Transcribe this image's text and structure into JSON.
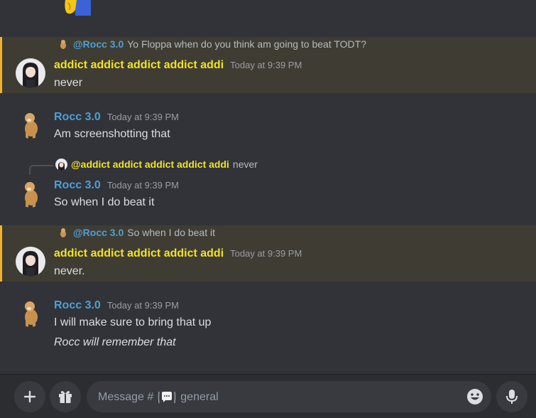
{
  "colors": {
    "background": "#313338",
    "highlight": "#3f3d33",
    "highlight_border": "#f0b232",
    "username_yellow": "#f2e22a",
    "username_blue": "#4e9fd6"
  },
  "messages": [
    {
      "reply": {
        "user": "@Rocc 3.0",
        "text": "Yo Floppa when do you think am going to beat TODT?"
      },
      "user": "addict addict addict addict addi",
      "time": "Today at 9:39 PM",
      "lines": [
        "never"
      ],
      "avatar": "anime-girl-avatar",
      "highlighted": true
    },
    {
      "user": "Rocc 3.0",
      "time": "Today at 9:39 PM",
      "lines": [
        "Am screenshotting that"
      ],
      "avatar": "cheems-dog-avatar"
    },
    {
      "reply": {
        "user": "@addict addict addict addict addi",
        "text": "never"
      },
      "user": "Rocc 3.0",
      "time": "Today at 9:39 PM",
      "lines": [
        "So when I do beat it"
      ],
      "avatar": "cheems-dog-avatar"
    },
    {
      "reply": {
        "user": "@Rocc 3.0",
        "text": "So when I do beat it"
      },
      "user": "addict addict addict addict addi",
      "time": "Today at 9:39 PM",
      "lines": [
        "never."
      ],
      "avatar": "anime-girl-avatar",
      "highlighted": true
    },
    {
      "user": "Rocc 3.0",
      "time": "Today at 9:39 PM",
      "lines": [
        "I will make sure to bring that up",
        "Rocc will remember that"
      ],
      "avatar": "cheems-dog-avatar"
    }
  ],
  "composer": {
    "placeholder_prefix": "Message #",
    "channel": "general",
    "icons": [
      "plus-icon",
      "gift-icon",
      "speech-bubble-icon",
      "emoji-icon",
      "microphone-icon"
    ]
  }
}
